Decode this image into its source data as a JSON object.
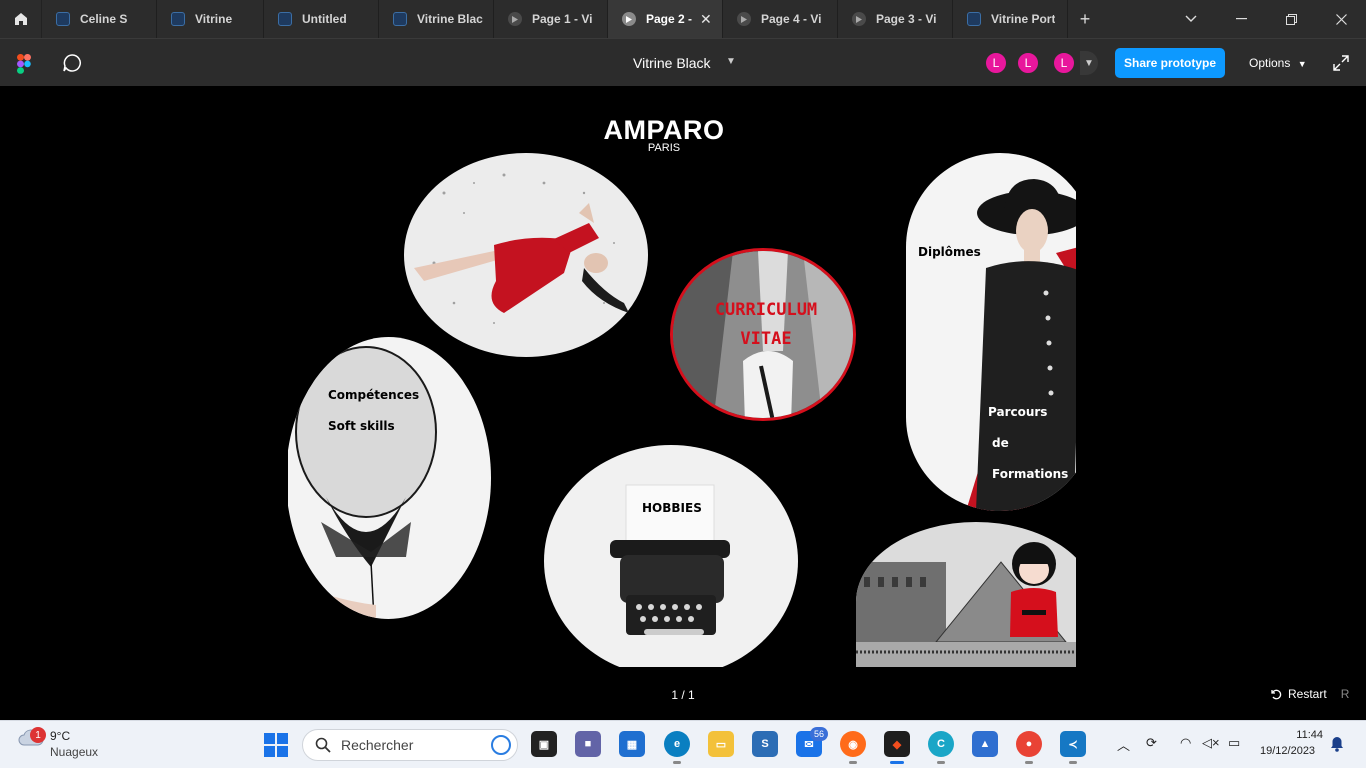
{
  "browser": {
    "tabs": [
      {
        "label": "Celine S",
        "kind": "figma",
        "active": false
      },
      {
        "label": "Vitrine",
        "kind": "figma",
        "active": false
      },
      {
        "label": "Untitled",
        "kind": "figma",
        "active": false
      },
      {
        "label": "Vitrine Blac",
        "kind": "figma",
        "active": false
      },
      {
        "label": "Page 1 - Vi",
        "kind": "prototype",
        "active": false
      },
      {
        "label": "Page 2 - ",
        "kind": "prototype",
        "active": true
      },
      {
        "label": "Page 4 - Vi",
        "kind": "prototype",
        "active": false
      },
      {
        "label": "Page 3 - Vi",
        "kind": "prototype",
        "active": false
      },
      {
        "label": "Vitrine Port",
        "kind": "figma",
        "active": false
      }
    ],
    "close_tab_glyph": "✕",
    "add_tab_glyph": "+"
  },
  "toolbar": {
    "file_title": "Vitrine Black",
    "avatars": [
      "L",
      "L",
      "L"
    ],
    "share_label": "Share prototype",
    "options_label": "Options"
  },
  "prototype": {
    "brand": "AMPARO",
    "brand_sub": "PARIS",
    "cv_line1": "CURRICULUM",
    "cv_line2": "VITAE",
    "diplomes": "Diplômes",
    "parcours_1": "Parcours",
    "parcours_2": "de",
    "parcours_3": "Formations",
    "competences": "Compétences",
    "soft_skills": "Soft skills",
    "hobbies": "HOBBIES",
    "accent_red": "#d50f1c",
    "page_counter": "1 / 1",
    "restart_label": "Restart",
    "restart_key": "R"
  },
  "taskbar": {
    "weather_temp": "9°C",
    "weather_desc": "Nuageux",
    "weather_badge": "1",
    "search_placeholder": "Rechercher",
    "mail_badge": "56",
    "time": "11:44",
    "date": "19/12/2023"
  }
}
